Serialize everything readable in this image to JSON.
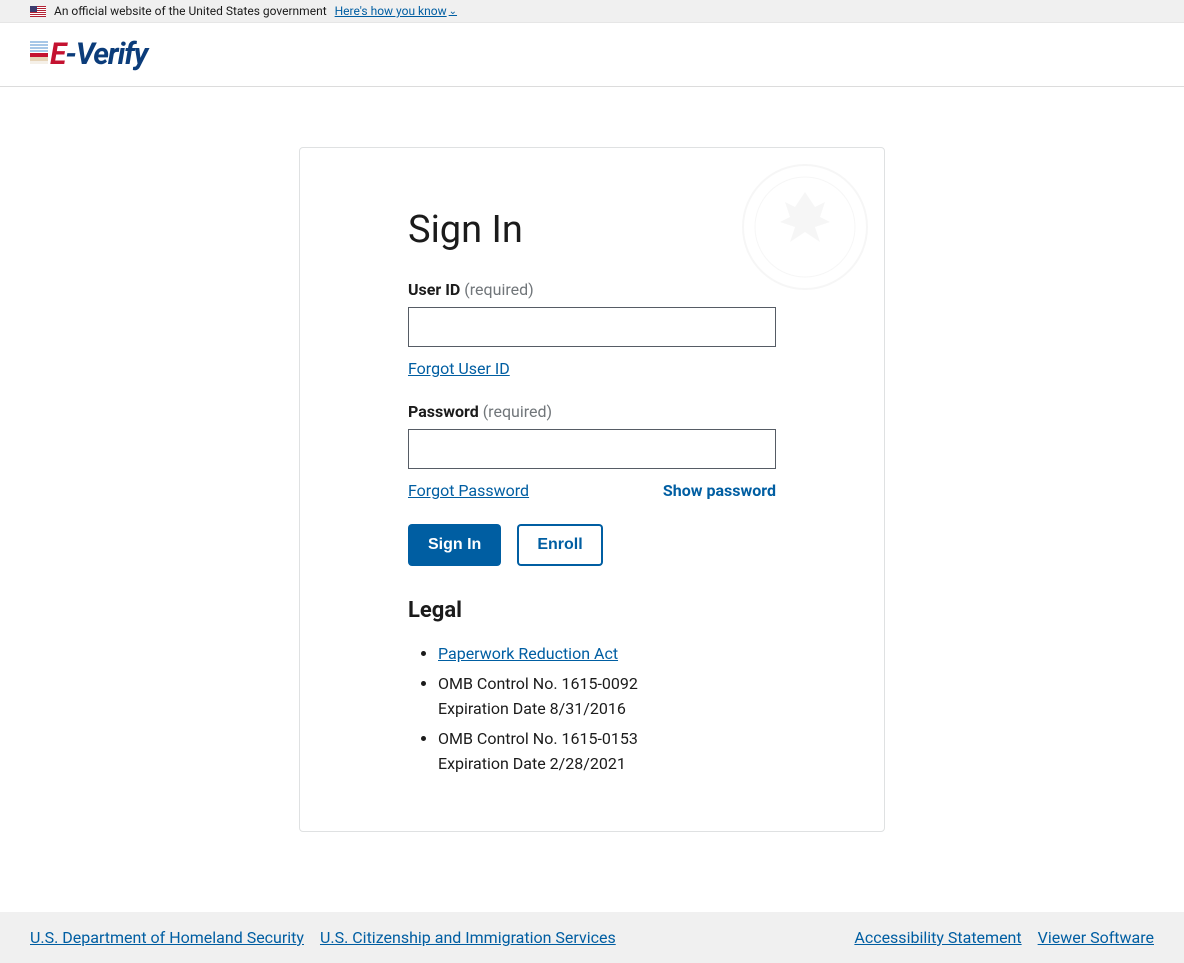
{
  "banner": {
    "text": "An official website of the United States government",
    "link": "Here's how you know"
  },
  "logo": {
    "e": "E",
    "rest": "-Verify"
  },
  "signin": {
    "title": "Sign In",
    "userid": {
      "label": "User ID",
      "required": "(required)",
      "forgot": "Forgot User ID"
    },
    "password": {
      "label": "Password",
      "required": "(required)",
      "forgot": "Forgot Password",
      "show": "Show password"
    },
    "buttons": {
      "signin": "Sign In",
      "enroll": "Enroll"
    }
  },
  "legal": {
    "heading": "Legal",
    "link1": "Paperwork Reduction Act",
    "item2_line1": "OMB Control No. 1615-0092",
    "item2_line2": "Expiration Date 8/31/2016",
    "item3_line1": "OMB Control No. 1615-0153",
    "item3_line2": "Expiration Date 2/28/2021"
  },
  "footer": {
    "dhs": "U.S. Department of Homeland Security",
    "uscis": "U.S. Citizenship and Immigration Services",
    "accessibility": "Accessibility Statement",
    "viewer": "Viewer Software"
  }
}
